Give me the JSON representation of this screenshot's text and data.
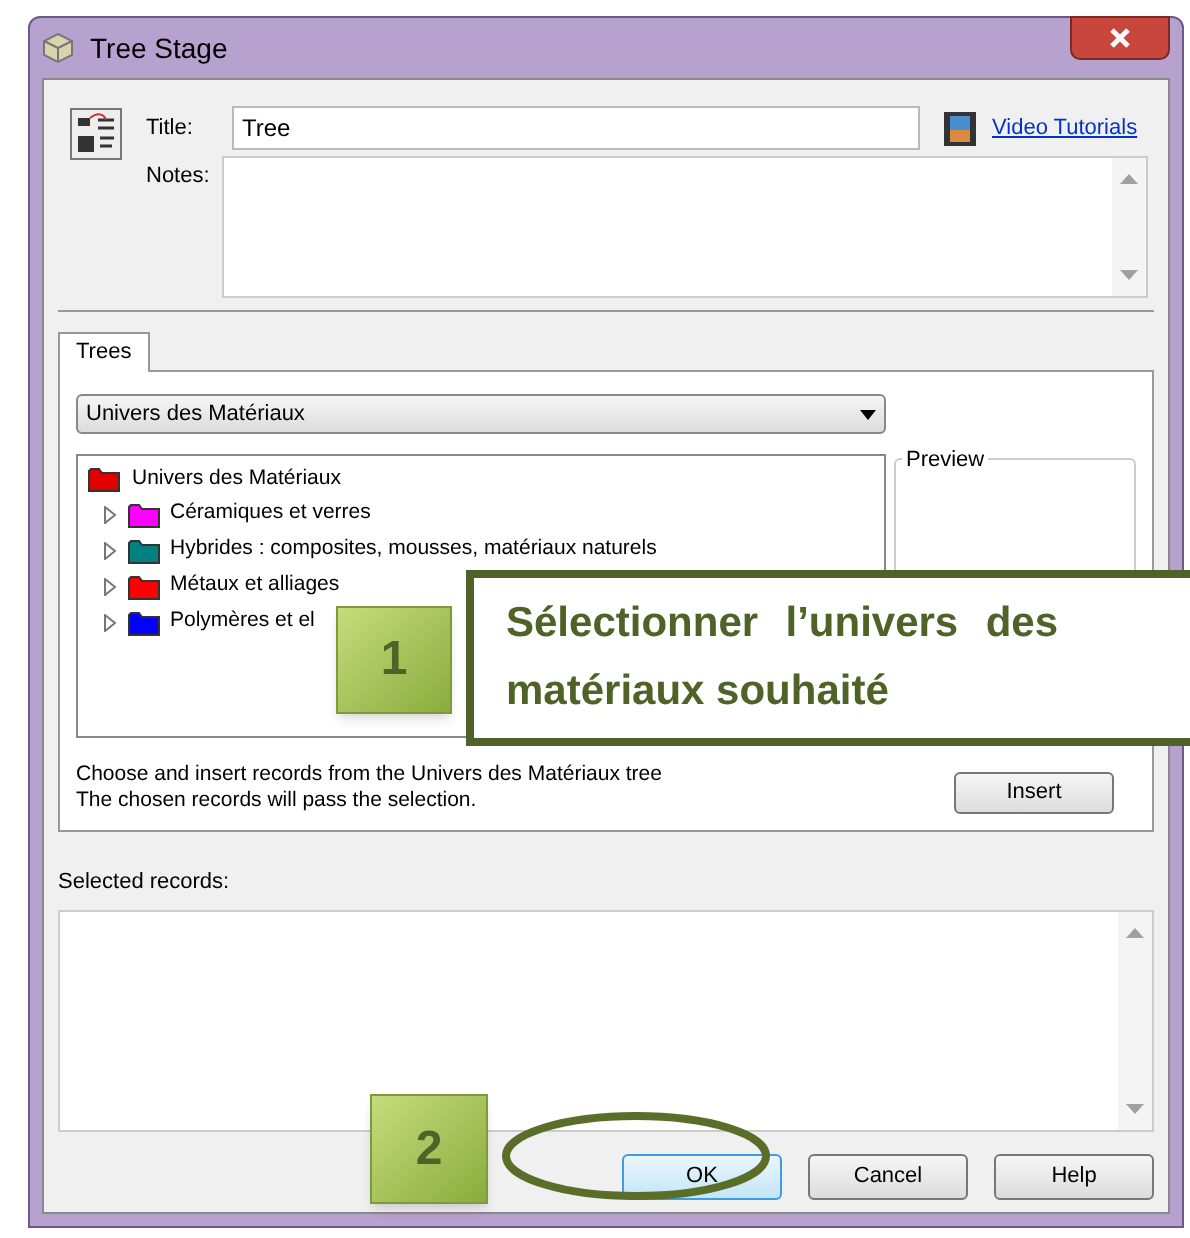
{
  "window": {
    "title": "Tree Stage"
  },
  "title_field": {
    "label": "Title:",
    "value": "Tree"
  },
  "video_link": "Video Tutorials",
  "notes": {
    "label": "Notes:"
  },
  "tabs": [
    {
      "label": "Trees",
      "selected": true
    }
  ],
  "tree_dropdown": {
    "value": "Univers des Matériaux"
  },
  "tree": {
    "label": "Univers des Matériaux",
    "color": "#e00000",
    "children": [
      {
        "label": "Céramiques et verres",
        "color": "#ff00ff",
        "expanded": false
      },
      {
        "label": "Hybrides : composites, mousses, matériaux naturels",
        "color": "#008080",
        "expanded": false
      },
      {
        "label": "Métaux et alliages",
        "color": "#ff0000",
        "expanded": false
      },
      {
        "label": "Polymères et el",
        "color": "#0000ff",
        "expanded": false
      }
    ]
  },
  "preview": {
    "label": "Preview"
  },
  "help_text": [
    "Choose and insert records from the Univers des Matériaux tree",
    "The chosen records will pass the selection."
  ],
  "insert_button": "Insert",
  "selected_records": {
    "label": "Selected records:"
  },
  "buttons": [
    {
      "label": "OK",
      "default": true
    },
    {
      "label": "Cancel",
      "default": false
    },
    {
      "label": "Help",
      "default": false
    }
  ],
  "annotations": {
    "step_1": "1",
    "callout": "Sélectionner l’univers des matériaux souhaité",
    "step_2": "2"
  }
}
